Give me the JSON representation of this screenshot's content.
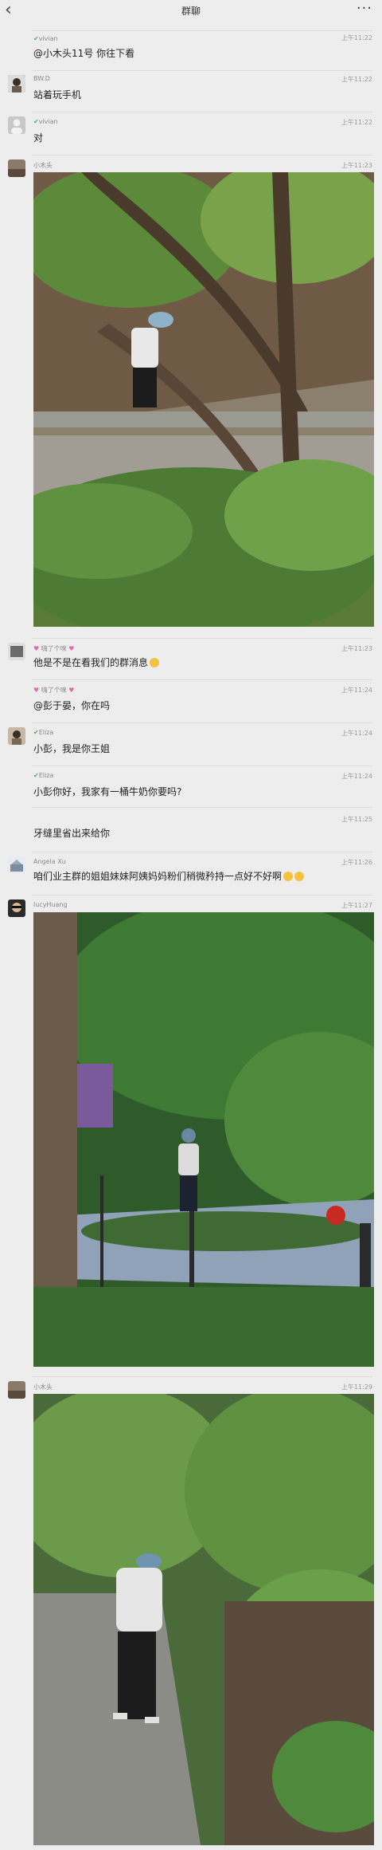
{
  "header": {
    "title": "群聊",
    "back_icon": "chevron-left-icon",
    "more_icon": "more-dots-icon"
  },
  "messages": [
    {
      "name": "vivian",
      "time": "上午11:22",
      "text": "@小木头11号 你往下看"
    },
    {
      "name": "BW.D",
      "time": "上午11:22",
      "text": "站着玩手机"
    },
    {
      "name": "vivian",
      "time": "上午11:22",
      "text": "对"
    },
    {
      "name": "小木头",
      "time": "上午11:23"
    },
    {
      "name": "嗨了个咪",
      "time": "上午11:23",
      "text": "他是不是在看我们的群消息"
    },
    {
      "name": "嗨了个咪",
      "time": "上午11:24",
      "text": "@彭于晏，你在吗"
    },
    {
      "name": "Eliza",
      "time": "上午11:24",
      "text": "小彭，我是你王姐"
    },
    {
      "name": "Eliza",
      "time": "上午11:24",
      "text": "小彭你好，我家有一桶牛奶你要吗?"
    },
    {
      "name": "",
      "time": "上午11:25",
      "text": "牙缝里省出来给你"
    },
    {
      "name": "Angela Xu",
      "time": "上午11:26",
      "text": "咱们业主群的姐姐妹妹阿姨妈妈粉们稍微矜持一点好不好啊"
    },
    {
      "name": "lucyHuang",
      "time": "上午11:27"
    },
    {
      "name": "小木头",
      "time": "上午11:29"
    }
  ]
}
